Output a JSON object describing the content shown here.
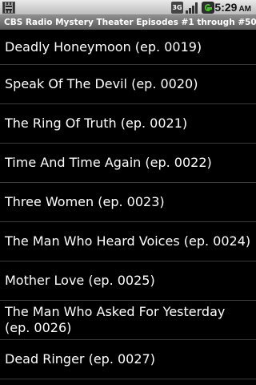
{
  "status_bar": {
    "time": "5:29",
    "time_suffix": "AM",
    "network_type": "3G",
    "icons": [
      "notification-icon",
      "3g-icon",
      "signal-icon",
      "battery-charging-icon"
    ]
  },
  "title_bar": {
    "title": "CBS Radio Mystery Theater Episodes #1 through #50"
  },
  "episodes": [
    {
      "label": "Deadly Honeymoon (ep. 0019)"
    },
    {
      "label": "Speak Of The Devil (ep. 0020)"
    },
    {
      "label": "The Ring Of Truth (ep. 0021)"
    },
    {
      "label": "Time And Time Again (ep. 0022)"
    },
    {
      "label": "Three Women (ep. 0023)"
    },
    {
      "label": "The Man Who Heard Voices (ep. 0024)"
    },
    {
      "label": "Mother Love (ep. 0025)"
    },
    {
      "label": "The Man Who Asked For Yesterday (ep. 0026)"
    },
    {
      "label": "Dead Ringer (ep. 0027)"
    }
  ]
}
